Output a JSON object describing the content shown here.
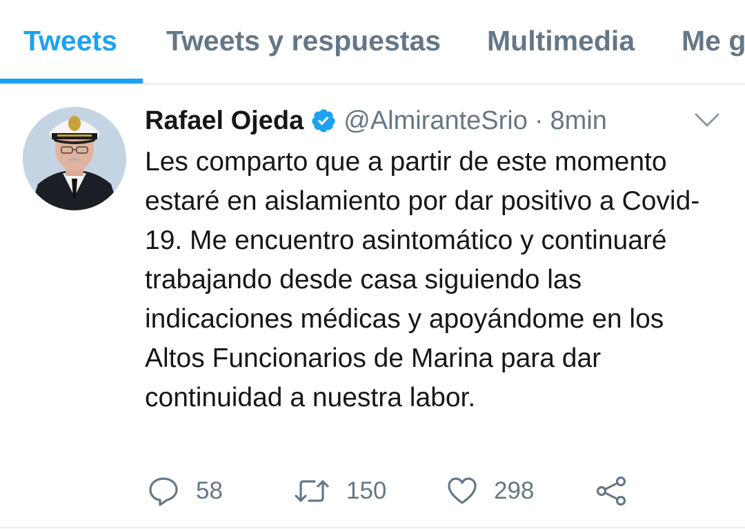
{
  "tabs": [
    {
      "label": "Tweets",
      "active": true
    },
    {
      "label": "Tweets y respuestas",
      "active": false
    },
    {
      "label": "Multimedia",
      "active": false
    },
    {
      "label": "Me g",
      "active": false
    }
  ],
  "tweet": {
    "author_name": "Rafael Ojeda",
    "handle": "@AlmiranteSrio",
    "separator": "·",
    "time": "8min",
    "verified": true,
    "text": "Les comparto que a partir de este momento estaré en aislamiento por dar positivo a Covid-19. Me encuentro asintomático y continuaré trabajando desde casa siguiendo las indicaciones médicas y apoyándome en los Altos Funcionarios de Marina para dar continuidad a nuestra labor.",
    "replies": "58",
    "retweets": "150",
    "likes": "298"
  },
  "colors": {
    "accent": "#1da1f2",
    "secondary_text": "#657786",
    "primary_text": "#14171a"
  },
  "icons": {
    "verified": "verified-badge-icon",
    "caret": "chevron-down-icon",
    "reply": "reply-icon",
    "retweet": "retweet-icon",
    "like": "heart-icon",
    "share": "share-icon"
  }
}
